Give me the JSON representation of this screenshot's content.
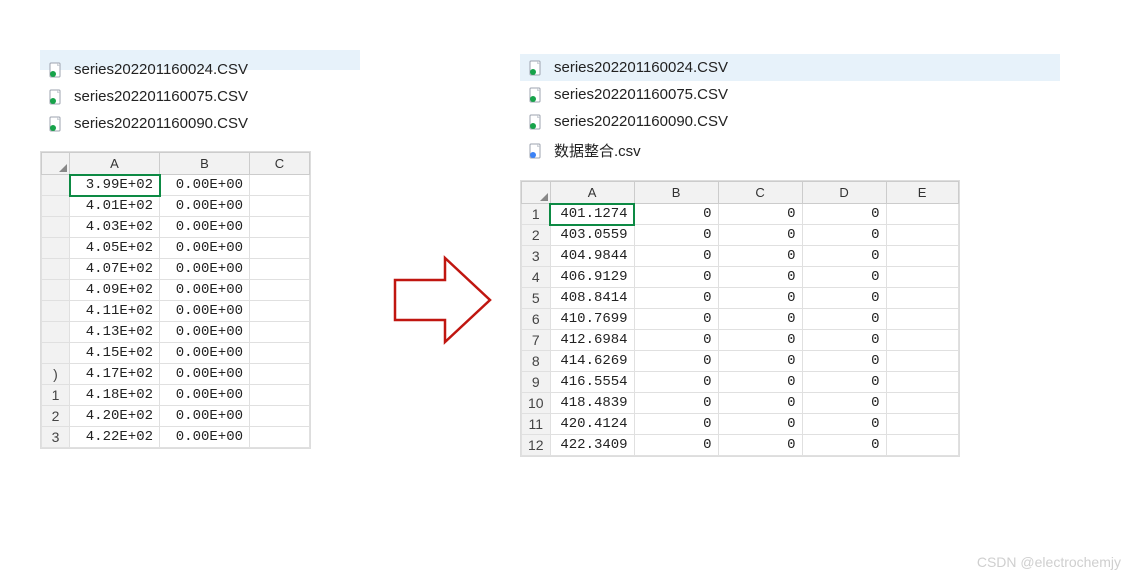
{
  "left": {
    "files": [
      {
        "name": "series202201160024.CSV",
        "icon": "csv-green-icon",
        "selected": false
      },
      {
        "name": "series202201160075.CSV",
        "icon": "csv-green-icon",
        "selected": false
      },
      {
        "name": "series202201160090.CSV",
        "icon": "csv-green-icon",
        "selected": false
      }
    ],
    "sheet": {
      "columns": [
        "A",
        "B",
        "C"
      ],
      "active_cell": "A1",
      "row_header_fragments": [
        " ",
        " ",
        " ",
        " ",
        " ",
        " ",
        " ",
        " ",
        " ",
        ")",
        "1",
        "2",
        "3"
      ],
      "rows": [
        [
          "3.99E+02",
          "0.00E+00",
          ""
        ],
        [
          "4.01E+02",
          "0.00E+00",
          ""
        ],
        [
          "4.03E+02",
          "0.00E+00",
          ""
        ],
        [
          "4.05E+02",
          "0.00E+00",
          ""
        ],
        [
          "4.07E+02",
          "0.00E+00",
          ""
        ],
        [
          "4.09E+02",
          "0.00E+00",
          ""
        ],
        [
          "4.11E+02",
          "0.00E+00",
          ""
        ],
        [
          "4.13E+02",
          "0.00E+00",
          ""
        ],
        [
          "4.15E+02",
          "0.00E+00",
          ""
        ],
        [
          "4.17E+02",
          "0.00E+00",
          ""
        ],
        [
          "4.18E+02",
          "0.00E+00",
          ""
        ],
        [
          "4.20E+02",
          "0.00E+00",
          ""
        ],
        [
          "4.22E+02",
          "0.00E+00",
          ""
        ]
      ]
    }
  },
  "right": {
    "files": [
      {
        "name": "series202201160024.CSV",
        "icon": "csv-green-icon",
        "selected": true
      },
      {
        "name": "series202201160075.CSV",
        "icon": "csv-green-icon",
        "selected": false
      },
      {
        "name": "series202201160090.CSV",
        "icon": "csv-green-icon",
        "selected": false
      },
      {
        "name": "数据整合.csv",
        "icon": "csv-blue-icon",
        "selected": false
      }
    ],
    "sheet": {
      "columns": [
        "A",
        "B",
        "C",
        "D",
        "E"
      ],
      "active_cell": "A1",
      "rows": [
        [
          "1",
          "401.1274",
          "0",
          "0",
          "0",
          ""
        ],
        [
          "2",
          "403.0559",
          "0",
          "0",
          "0",
          ""
        ],
        [
          "3",
          "404.9844",
          "0",
          "0",
          "0",
          ""
        ],
        [
          "4",
          "406.9129",
          "0",
          "0",
          "0",
          ""
        ],
        [
          "5",
          "408.8414",
          "0",
          "0",
          "0",
          ""
        ],
        [
          "6",
          "410.7699",
          "0",
          "0",
          "0",
          ""
        ],
        [
          "7",
          "412.6984",
          "0",
          "0",
          "0",
          ""
        ],
        [
          "8",
          "414.6269",
          "0",
          "0",
          "0",
          ""
        ],
        [
          "9",
          "416.5554",
          "0",
          "0",
          "0",
          ""
        ],
        [
          "10",
          "418.4839",
          "0",
          "0",
          "0",
          ""
        ],
        [
          "11",
          "420.4124",
          "0",
          "0",
          "0",
          ""
        ],
        [
          "12",
          "422.3409",
          "0",
          "0",
          "0",
          ""
        ]
      ]
    }
  },
  "watermark": "CSDN @electrochemjy",
  "colors": {
    "arrow_stroke": "#c01610",
    "selection_bg": "#e7f2fa",
    "active_cell": "#0d8a44"
  }
}
